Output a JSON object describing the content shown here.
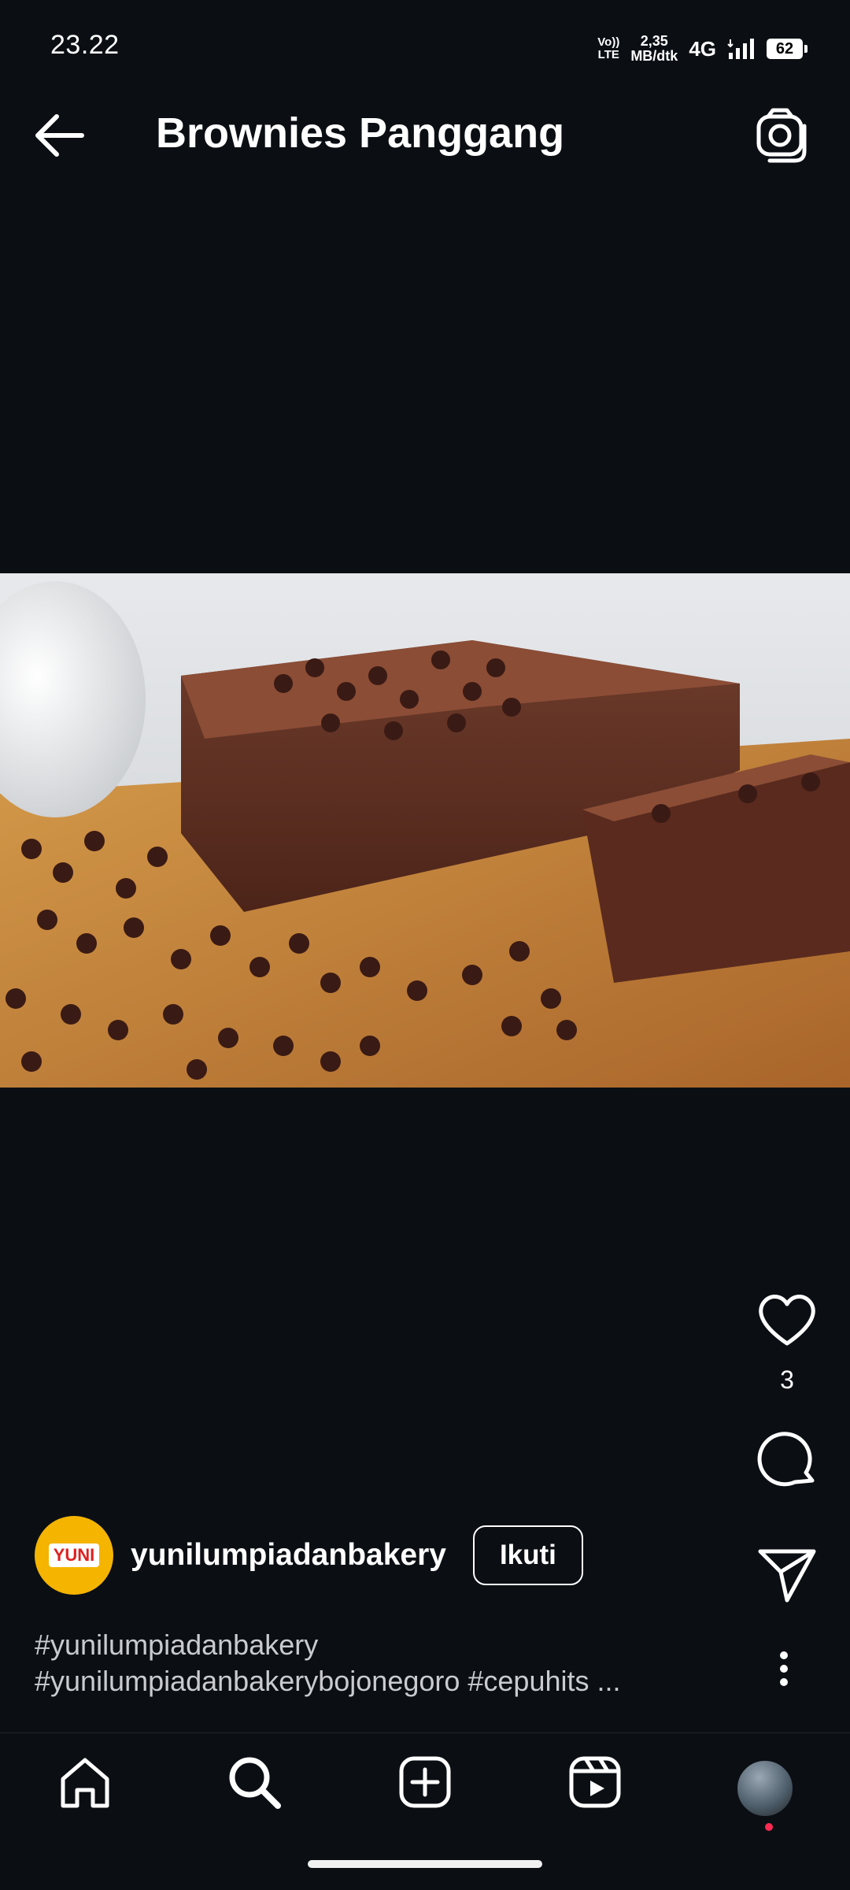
{
  "status": {
    "time": "23.22",
    "volte_top": "Vo))",
    "volte_bottom": "LTE",
    "speed_top": "2,35",
    "speed_bottom": "MB/dtk",
    "network": "4G",
    "battery": "62"
  },
  "header": {
    "title": "Brownies Panggang",
    "back_icon": "arrow-left-icon",
    "camera_icon": "camera-icon"
  },
  "post": {
    "image_description": "brownies-with-chocolate-buttons",
    "like_count": "3",
    "author": {
      "username": "yunilumpiadanbakery",
      "avatar_text": "YUNI",
      "follow_label": "Ikuti"
    },
    "caption_lines": [
      "#yunilumpiadanbakery",
      "#yunilumpiadanbakerybojonegoro #cepuhits ..."
    ]
  },
  "bottom_nav": {
    "items": [
      "home-icon",
      "search-icon",
      "add-post-icon",
      "reels-icon",
      "profile-avatar"
    ]
  },
  "colors": {
    "background": "#0b0f14",
    "text": "#ffffff",
    "caption": "#c9cbcf",
    "notification_dot": "#ff2a52"
  }
}
